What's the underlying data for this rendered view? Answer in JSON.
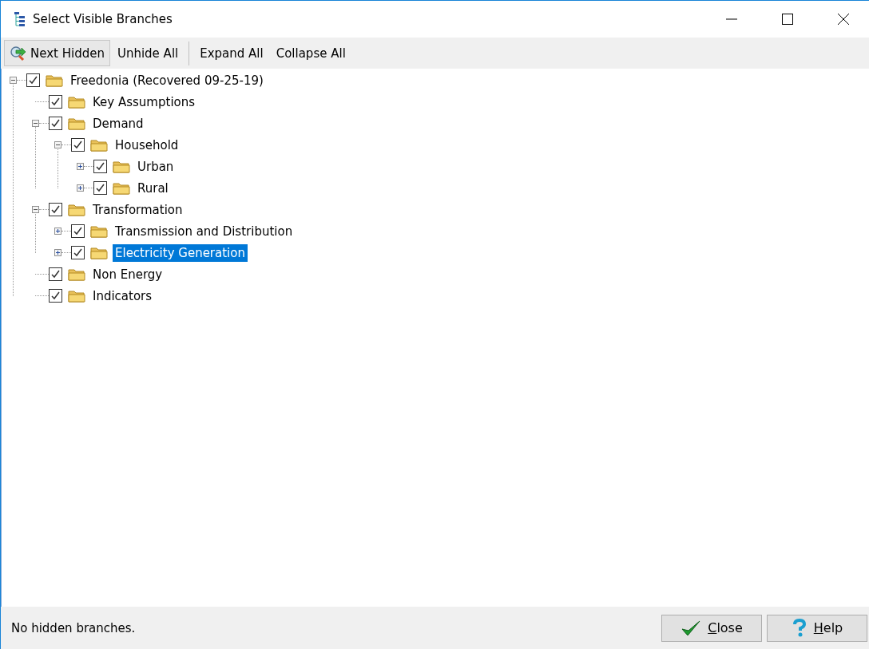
{
  "window": {
    "title": "Select Visible Branches"
  },
  "toolbar": [
    {
      "label": "Next Hidden",
      "kind": "icon-button"
    },
    {
      "label": "Unhide All",
      "kind": "button"
    },
    {
      "label": "Expand All",
      "kind": "button"
    },
    {
      "label": "Collapse All",
      "kind": "button"
    }
  ],
  "tree": [
    {
      "label": "Freedonia (Recovered 09-25-19)",
      "checked": true,
      "selected": false,
      "expanded": true,
      "children": [
        {
          "label": "Key Assumptions",
          "checked": true,
          "selected": false
        },
        {
          "label": "Demand",
          "checked": true,
          "selected": false,
          "expanded": true,
          "children": [
            {
              "label": "Household",
              "checked": true,
              "selected": false,
              "expanded": true,
              "children": [
                {
                  "label": "Urban",
                  "checked": true,
                  "selected": false,
                  "expanded": false
                },
                {
                  "label": "Rural",
                  "checked": true,
                  "selected": false,
                  "expanded": false
                }
              ]
            }
          ]
        },
        {
          "label": "Transformation",
          "checked": true,
          "selected": false,
          "expanded": true,
          "children": [
            {
              "label": "Transmission and Distribution",
              "checked": true,
              "selected": false,
              "expanded": false
            },
            {
              "label": "Electricity Generation",
              "checked": true,
              "selected": true,
              "expanded": false
            }
          ]
        },
        {
          "label": "Non Energy",
          "checked": true,
          "selected": false
        },
        {
          "label": "Indicators",
          "checked": true,
          "selected": false
        }
      ]
    }
  ],
  "status_bar": {
    "text": "No hidden branches."
  },
  "buttons": [
    {
      "label": "Close",
      "kind": "close",
      "underline_first": true
    },
    {
      "label": "Help",
      "kind": "help",
      "underline_first": true
    }
  ]
}
